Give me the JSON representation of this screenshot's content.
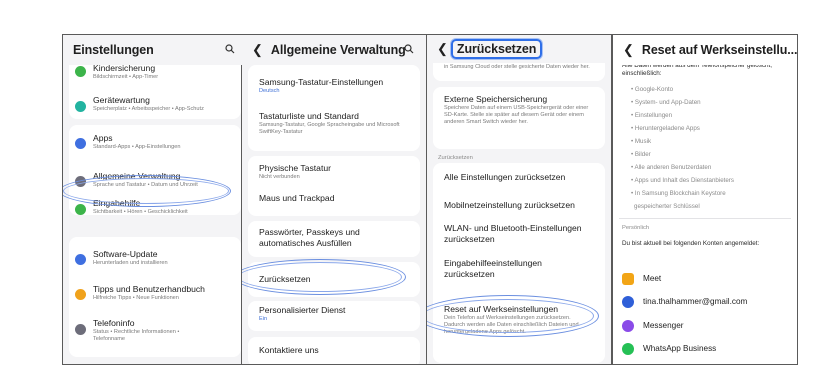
{
  "panel1": {
    "title": "Einstellungen",
    "search_icon": "search-icon",
    "items": [
      {
        "title": "Kindersicherung",
        "sub": "Bildschirmzeit • App-Timer",
        "icon": "family-icon",
        "color": "#3cb44a"
      },
      {
        "title": "Gerätewartung",
        "sub": "Speicherplatz • Arbeitsspeicher • App-Schutz",
        "icon": "device-care-icon",
        "color": "#22b3a0"
      },
      {
        "title": "Apps",
        "sub": "Standard-Apps • App-Einstellungen",
        "icon": "apps-icon",
        "color": "#3f6fe0"
      },
      {
        "title": "Allgemeine Verwaltung",
        "sub": "Sprache und Tastatur • Datum und Uhrzeit",
        "icon": "general-management-icon",
        "color": "#6d6d7a"
      },
      {
        "title": "Eingabehilfe",
        "sub": "Sichtbarkeit • Hören • Geschicklichkeit",
        "icon": "accessibility-icon",
        "color": "#3cb44a"
      },
      {
        "title": "Software-Update",
        "sub": "Herunterladen und installieren",
        "icon": "software-update-icon",
        "color": "#3f6fe0"
      },
      {
        "title": "Tipps und Benutzerhandbuch",
        "sub": "Hilfreiche Tipps • Neue Funktionen",
        "icon": "tips-icon",
        "color": "#f0a21c"
      },
      {
        "title": "Telefoninfo",
        "sub": "Status • Rechtliche Informationen • Telefonname",
        "icon": "phone-info-icon",
        "color": "#6d6d7a"
      }
    ]
  },
  "panel2": {
    "title": "Allgemeine Verwaltung",
    "items": [
      {
        "title": "Samsung-Tastatur-Einstellungen",
        "sub": "Deutsch"
      },
      {
        "title": "Tastaturliste und Standard",
        "sub": "Samsung-Tastatur, Google Spracheingabe und Microsoft SwiftKey-Tastatur"
      },
      {
        "title": "Physische Tastatur",
        "sub": "Nicht verbunden"
      },
      {
        "title": "Maus und Trackpad",
        "sub": ""
      },
      {
        "title": "Passwörter, Passkeys und automatisches Ausfüllen",
        "sub": ""
      },
      {
        "title": "Zurücksetzen",
        "sub": ""
      },
      {
        "title": "Personalisierter Dienst",
        "sub": "Ein"
      },
      {
        "title": "Kontaktiere uns",
        "sub": ""
      }
    ]
  },
  "panel3": {
    "title": "Zurücksetzen",
    "top_sub": "in Samsung Cloud oder stelle gesicherte Daten wieder her.",
    "items": [
      {
        "title": "Externe Speichersicherung",
        "sub": "Speichere Daten auf einem USB-Speichergerät oder einer SD-Karte. Stelle sie später auf diesem Gerät oder einem anderen Smart Switch wieder her."
      },
      {
        "title": "Alle Einstellungen zurücksetzen",
        "sub": ""
      },
      {
        "title": "Mobilnetzeinstellung zurücksetzen",
        "sub": ""
      },
      {
        "title": "WLAN- und Bluetooth-Einstellungen zurücksetzen",
        "sub": ""
      },
      {
        "title": "Eingabehilfeeinstellungen zurücksetzen",
        "sub": ""
      },
      {
        "title": "Reset auf Werkseinstellungen",
        "sub": "Dein Telefon auf Werkseinstellungen zurücksetzen. Dadurch werden alle Daten einschließlich Dateien und heruntergeladene Apps gelöscht."
      }
    ],
    "section": "Zurücksetzen"
  },
  "panel4": {
    "title": "Reset auf Werkseinstellu...",
    "intro": "Alle Daten werden aus dem Telefonspeicher gelöscht, einschließlich:",
    "bullets": [
      "• Google-Konto",
      "• System- und App-Daten",
      "• Einstellungen",
      "• Heruntergeladene Apps",
      "• Musik",
      "• Bilder",
      "• Alle anderen Benutzerdaten",
      "• Apps und Inhalt des Dienstanbieters",
      "• In Samsung Blockchain Keystore",
      "gespeicherter Schlüssel"
    ],
    "section": "Persönlich",
    "accounts_intro": "Du bist aktuell bei folgenden Konten angemeldet:",
    "accounts": [
      {
        "name": "Meet",
        "icon": "meet-icon",
        "color": "#f2a516"
      },
      {
        "name": "tina.thalhammer@gmail.com",
        "icon": "samsung-account-icon",
        "color": "#2f5fd8"
      },
      {
        "name": "Messenger",
        "icon": "messenger-icon",
        "color": "#8a4be8"
      },
      {
        "name": "WhatsApp Business",
        "icon": "whatsapp-business-icon",
        "color": "#25c055"
      }
    ]
  }
}
